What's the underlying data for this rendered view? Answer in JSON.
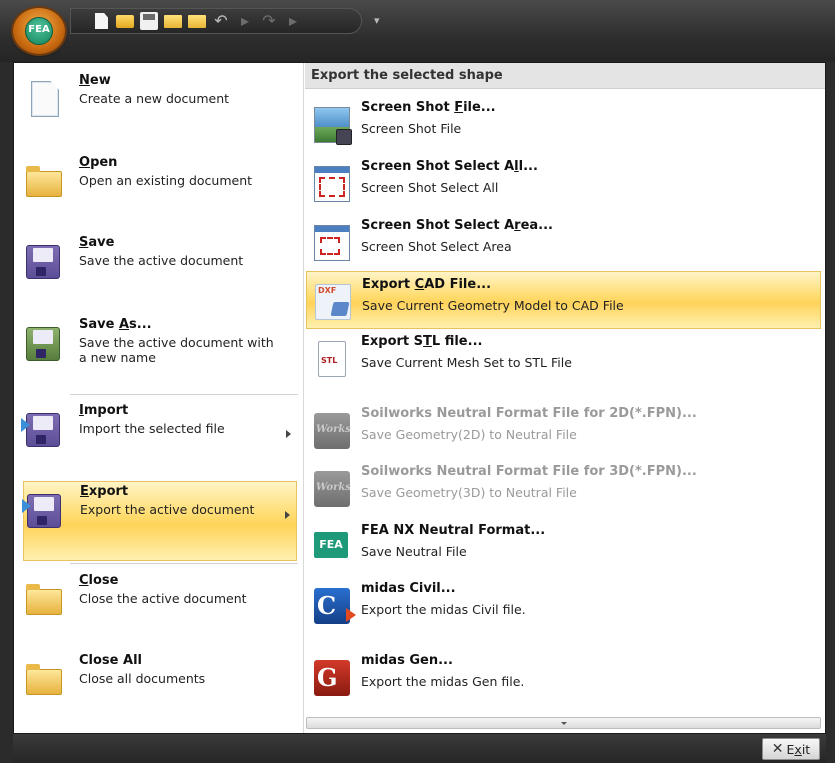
{
  "app": {
    "orb_label": "FEA"
  },
  "left_menu": [
    {
      "title_pre": "",
      "title_u": "N",
      "title_post": "ew",
      "desc": "Create a new document",
      "icon": "new-document-icon"
    },
    {
      "title_pre": "",
      "title_u": "O",
      "title_post": "pen",
      "desc": "Open an existing document",
      "icon": "open-folder-icon"
    },
    {
      "title_pre": "",
      "title_u": "S",
      "title_post": "ave",
      "desc": "Save the active document",
      "icon": "save-disk-icon"
    },
    {
      "title_pre": "Save ",
      "title_u": "A",
      "title_post": "s...",
      "desc": "Save the active document with a new name",
      "icon": "save-as-icon"
    },
    {
      "title_pre": "",
      "title_u": "I",
      "title_post": "mport",
      "desc": "Import the selected file",
      "icon": "import-icon"
    },
    {
      "title_pre": "",
      "title_u": "E",
      "title_post": "xport",
      "desc": "Export the active document",
      "icon": "export-icon"
    },
    {
      "title_pre": "",
      "title_u": "C",
      "title_post": "lose",
      "desc": "Close the active document",
      "icon": "close-folder-icon"
    },
    {
      "title_pre": "Close All",
      "title_u": "",
      "title_post": "",
      "desc": "Close all documents",
      "icon": "close-all-icon"
    }
  ],
  "right_pane": {
    "header": "Export the selected shape",
    "items": [
      {
        "title_pre": "Screen Shot ",
        "title_u": "F",
        "title_post": "ile...",
        "desc": "Screen Shot File",
        "icon": "screenshot-file-icon"
      },
      {
        "title_pre": "Screen Shot Select A",
        "title_u": "l",
        "title_post": "l...",
        "desc": "Screen Shot Select All",
        "icon": "screenshot-select-all-icon"
      },
      {
        "title_pre": "Screen Shot Select A",
        "title_u": "r",
        "title_post": "ea...",
        "desc": "Screen Shot Select Area",
        "icon": "screenshot-select-area-icon"
      },
      {
        "title_pre": "Export ",
        "title_u": "C",
        "title_post": "AD File...",
        "desc": "Save Current Geometry Model to CAD File",
        "icon": "dxf-cad-icon"
      },
      {
        "title_pre": "Export S",
        "title_u": "T",
        "title_post": "L file...",
        "desc": "Save Current Mesh Set to STL File",
        "icon": "stl-file-icon"
      },
      {
        "title_pre": "Soilworks Neutral Format File for 2D(*.FPN)...",
        "title_u": "",
        "title_post": "",
        "desc": "Save Geometry(2D) to Neutral File",
        "icon": "soilworks-icon"
      },
      {
        "title_pre": "Soilworks Neutral Format File for 3D(*.FPN)...",
        "title_u": "",
        "title_post": "",
        "desc": "Save Geometry(3D) to Neutral File",
        "icon": "soilworks-icon"
      },
      {
        "title_pre": "FEA NX Neutral Format...",
        "title_u": "",
        "title_post": "",
        "desc": "Save Neutral File",
        "icon": "fea-icon"
      },
      {
        "title_pre": "midas Civil...",
        "title_u": "",
        "title_post": "",
        "desc": "Export the midas Civil file.",
        "icon": "midas-civil-icon"
      },
      {
        "title_pre": "midas Gen...",
        "title_u": "",
        "title_post": "",
        "desc": "Export the midas Gen file.",
        "icon": "midas-gen-icon"
      }
    ],
    "icon_text": {
      "dxf": "DXF",
      "stl": "STL",
      "sw": "Works",
      "fea": "FEA",
      "civil": "C",
      "gen": "G"
    }
  },
  "footer": {
    "exit_pre": "E",
    "exit_u": "x",
    "exit_post": "it"
  },
  "colors": {
    "highlight": "#ffd35a",
    "header_bg": "#e4e4e4",
    "frame_bg": "#2b2b2b"
  }
}
